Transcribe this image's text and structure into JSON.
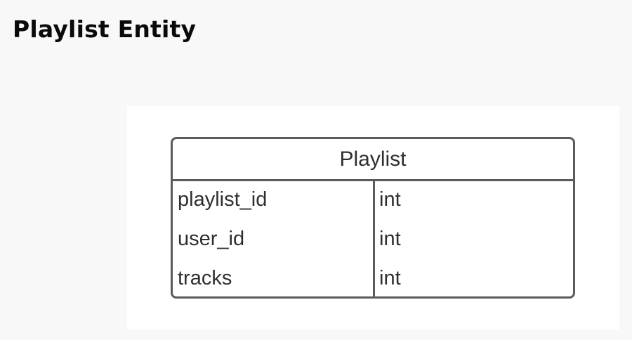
{
  "page": {
    "title": "Playlist Entity"
  },
  "entity": {
    "name": "Playlist",
    "attributes": [
      {
        "name": "playlist_id",
        "type": "int"
      },
      {
        "name": "user_id",
        "type": "int"
      },
      {
        "name": "tracks",
        "type": "int"
      }
    ]
  },
  "colors": {
    "background": "#f8f8f8",
    "panel": "#ffffff",
    "border": "#5b5b5b",
    "text": "#2f2f2f"
  }
}
